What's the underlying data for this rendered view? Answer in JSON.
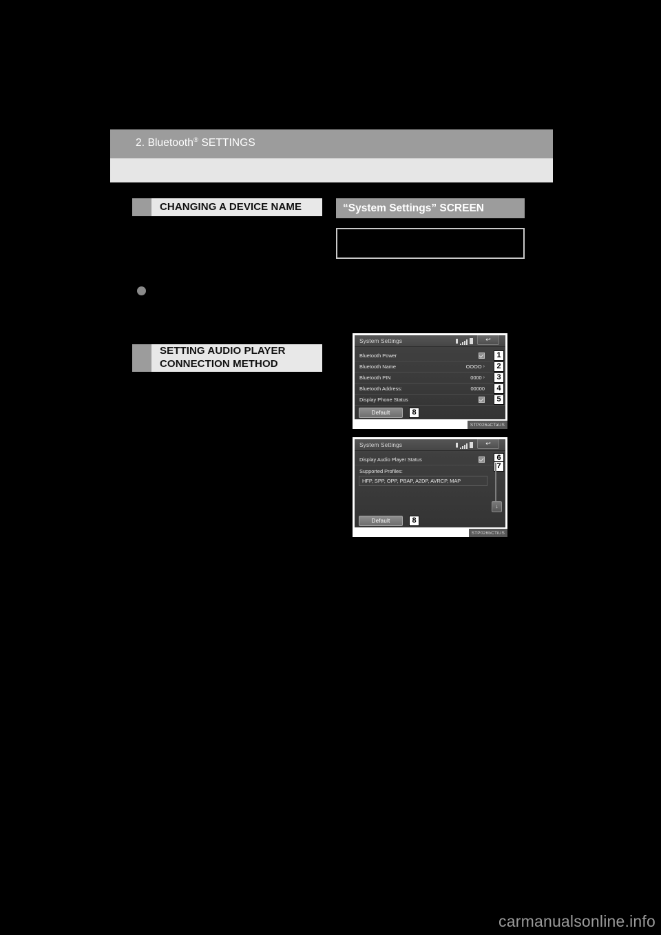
{
  "page": {
    "chapter_number": "2.",
    "chapter_title_main": "Bluetooth",
    "chapter_title_sup": "®",
    "chapter_title_tail": " SETTINGS",
    "watermark": "carmanualsonline.info"
  },
  "sections": {
    "changing_device_name": "CHANGING A DEVICE NAME",
    "setting_audio_player_line1": "SETTING AUDIO PLAYER",
    "setting_audio_player_line2": "CONNECTION METHOD",
    "system_settings_screen": "“System Settings” SCREEN"
  },
  "screenshot_1": {
    "title": "System Settings",
    "back_icon": "↩",
    "caption": "STP026aCTaUS",
    "default_button": "Default",
    "default_callout": "8",
    "rows": [
      {
        "label": "Bluetooth Power",
        "value": "",
        "control": "checkbox",
        "chevron": false,
        "callout": "1"
      },
      {
        "label": "Bluetooth Name",
        "value": "OOOO",
        "control": "text",
        "chevron": true,
        "callout": "2"
      },
      {
        "label": "Bluetooth PIN",
        "value": "0000",
        "control": "text",
        "chevron": true,
        "callout": "3"
      },
      {
        "label": "Bluetooth Address:",
        "value": "00000",
        "control": "text",
        "chevron": false,
        "callout": "4"
      },
      {
        "label": "Display Phone Status",
        "value": "",
        "control": "checkbox",
        "chevron": false,
        "callout": "5"
      }
    ]
  },
  "screenshot_2": {
    "title": "System Settings",
    "back_icon": "↩",
    "caption": "STP026bCTiUS",
    "default_button": "Default",
    "default_callout": "8",
    "audio_status_label": "Display Audio Player Status",
    "audio_status_callout": "6",
    "profiles_label": "Supported Profiles:",
    "profiles_value": "HFP, SPP, OPP, PBAP, A2DP, AVRCP, MAP",
    "profiles_callout": "7",
    "scroll_down_icon": "↓"
  },
  "colors": {
    "page_background": "#000000",
    "header_bar": "#9c9c9c",
    "subheader_bar": "#e6e6e6",
    "section_light": "#e8e8e8",
    "section_tab": "#9c9c9c",
    "device_screen": "#3f3f3f",
    "watermark": "#9a9a9a"
  }
}
